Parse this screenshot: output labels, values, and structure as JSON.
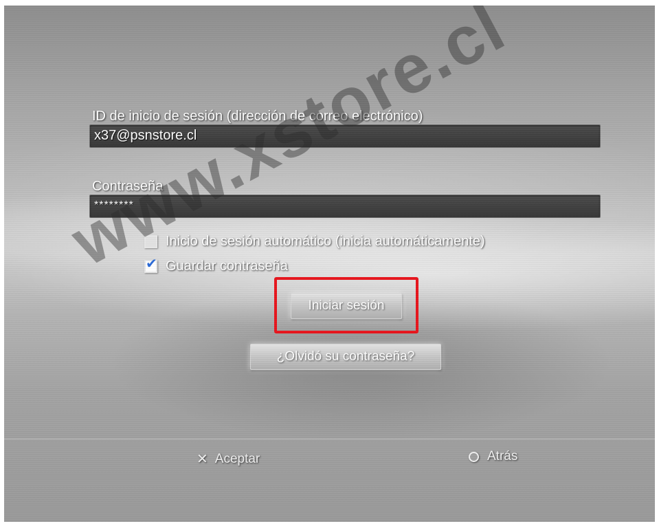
{
  "login_form": {
    "id_label": "ID de inicio de sesión (dirección de correo electrónico)",
    "id_value": "x37@psnstore.cl",
    "password_label": "Contraseña",
    "password_value": "********",
    "auto_login_label": "Inicio de sesión automático (inicia automáticamente)",
    "auto_login_checked": false,
    "save_password_label": "Guardar contraseña",
    "save_password_checked": true,
    "sign_in_button": "Iniciar sesión",
    "forgot_password_button": "¿Olvidó su contraseña?"
  },
  "footer": {
    "accept_icon": "cross-icon",
    "accept_label": "Aceptar",
    "back_icon": "circle-icon",
    "back_label": "Atrás"
  },
  "watermark": {
    "text": "www.xstore.cl"
  },
  "colors": {
    "highlight": "#e8141c",
    "check_accent": "#2a6ad8",
    "field_background": "#3c3c3c"
  }
}
